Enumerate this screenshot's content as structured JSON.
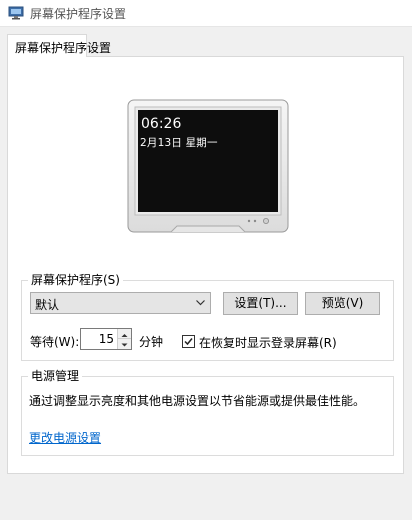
{
  "window": {
    "title": "屏幕保护程序设置"
  },
  "tabs": [
    {
      "label": "屏幕保护程序设置"
    }
  ],
  "preview": {
    "time": "06:26",
    "date": "2月13日  星期一"
  },
  "screensaver_group": {
    "legend": "屏幕保护程序(S)",
    "selected": "默认",
    "settings_button": "设置(T)...",
    "preview_button": "预览(V)",
    "wait_label": "等待(W):",
    "wait_value": "15",
    "wait_unit": "分钟",
    "resume_checkbox_label": "在恢复时显示登录屏幕(R)",
    "resume_checked": true
  },
  "power_group": {
    "legend": "电源管理",
    "description": "通过调整显示亮度和其他电源设置以节省能源或提供最佳性能。",
    "link": "更改电源设置"
  },
  "icons": {
    "app": "monitor-icon",
    "dropdown": "chevron-down-icon",
    "spin_up": "arrow-up-icon",
    "spin_down": "arrow-down-icon",
    "check": "checkmark-icon"
  },
  "colors": {
    "link": "#0066cc",
    "screen": "#0d0d0d",
    "window_bg": "#f0f0f0"
  }
}
